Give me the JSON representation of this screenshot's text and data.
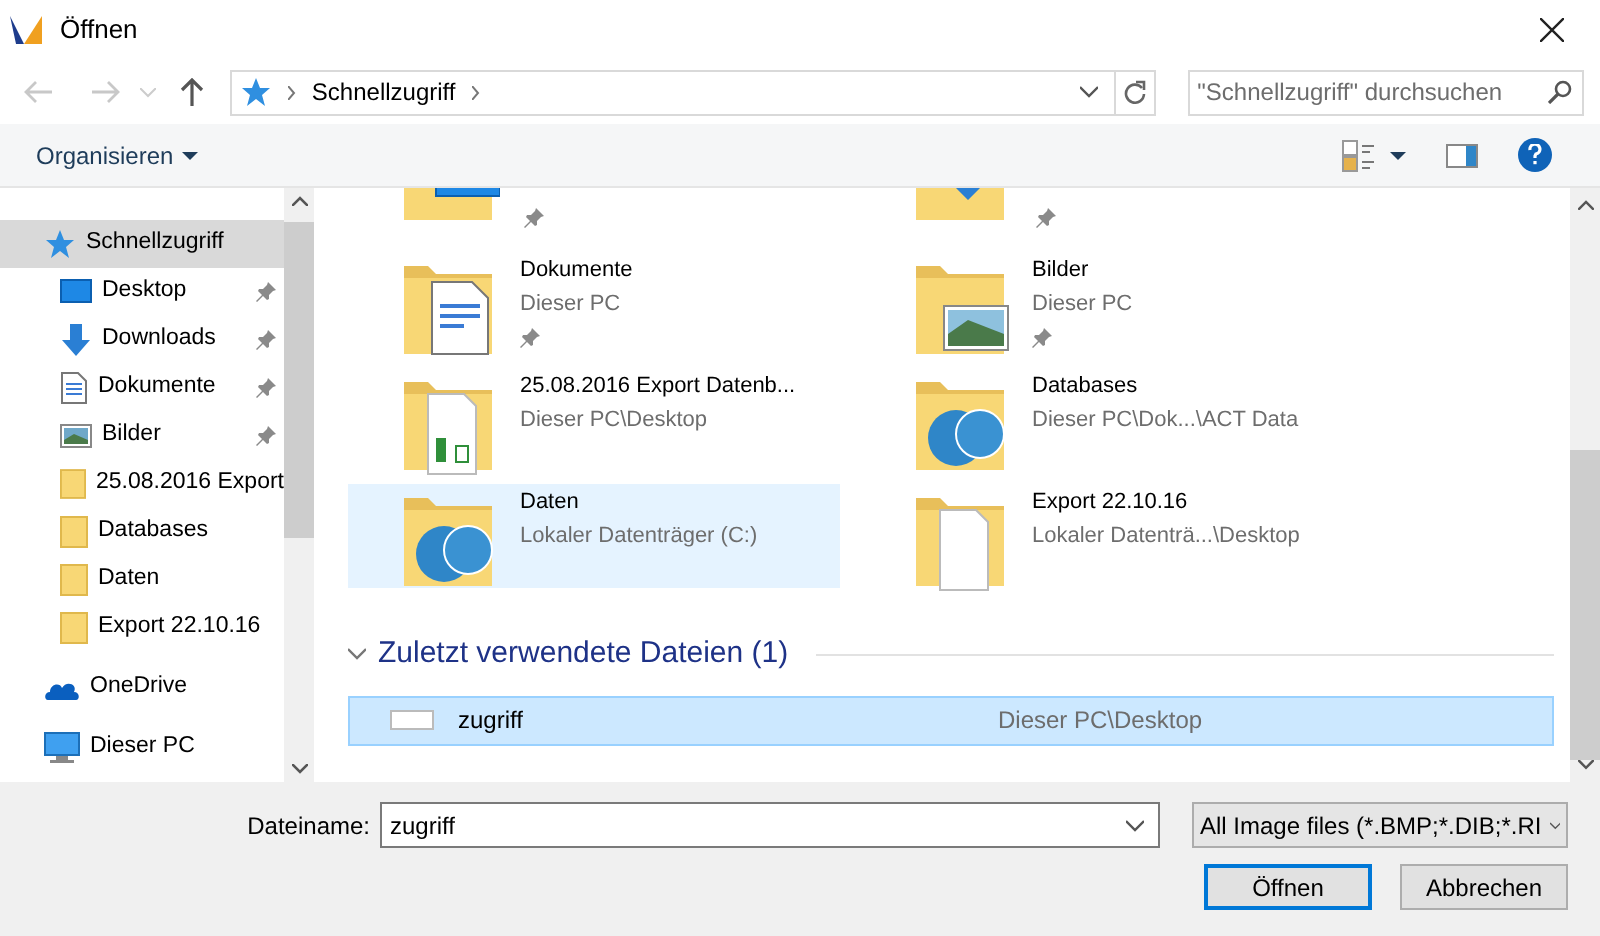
{
  "window": {
    "title": "Öffnen"
  },
  "address": {
    "path": "Schnellzugriff"
  },
  "search": {
    "placeholder": "\"Schnellzugriff\" durchsuchen"
  },
  "toolbar": {
    "organize": "Organisieren"
  },
  "sidebar": {
    "items": [
      {
        "label": "Schnellzugriff",
        "kind": "star",
        "selected": true,
        "pinned": false,
        "indent": false
      },
      {
        "label": "Desktop",
        "kind": "desktop",
        "selected": false,
        "pinned": true,
        "indent": true
      },
      {
        "label": "Downloads",
        "kind": "download",
        "selected": false,
        "pinned": true,
        "indent": true
      },
      {
        "label": "Dokumente",
        "kind": "document",
        "selected": false,
        "pinned": true,
        "indent": true
      },
      {
        "label": "Bilder",
        "kind": "picture",
        "selected": false,
        "pinned": true,
        "indent": true
      },
      {
        "label": "25.08.2016 Export",
        "kind": "folder",
        "selected": false,
        "pinned": false,
        "indent": true
      },
      {
        "label": "Databases",
        "kind": "folder",
        "selected": false,
        "pinned": false,
        "indent": true
      },
      {
        "label": "Daten",
        "kind": "folder",
        "selected": false,
        "pinned": false,
        "indent": true
      },
      {
        "label": "Export 22.10.16",
        "kind": "folder",
        "selected": false,
        "pinned": false,
        "indent": true
      },
      {
        "label": "OneDrive",
        "kind": "cloud",
        "selected": false,
        "pinned": false,
        "indent": false
      },
      {
        "label": "Dieser PC",
        "kind": "pc",
        "selected": false,
        "pinned": false,
        "indent": false
      }
    ]
  },
  "partial_tiles": [
    {
      "kind": "desktop",
      "pinned": true
    },
    {
      "kind": "download",
      "pinned": true
    }
  ],
  "tiles": [
    {
      "title": "Dokumente",
      "subtitle": "Dieser PC",
      "kind": "document",
      "pinned": true,
      "selected": false
    },
    {
      "title": "Bilder",
      "subtitle": "Dieser PC",
      "kind": "picture",
      "pinned": true,
      "selected": false
    },
    {
      "title": "25.08.2016 Export Datenb...",
      "subtitle": "Dieser PC\\Desktop",
      "kind": "sheet",
      "pinned": false,
      "selected": false
    },
    {
      "title": "Databases",
      "subtitle": "Dieser PC\\Dok...\\ACT Data",
      "kind": "act",
      "pinned": false,
      "selected": false
    },
    {
      "title": "Daten",
      "subtitle": "Lokaler Datenträger (C:)",
      "kind": "act",
      "pinned": false,
      "selected": true
    },
    {
      "title": "Export 22.10.16",
      "subtitle": "Lokaler Datenträ...\\Desktop",
      "kind": "paper",
      "pinned": false,
      "selected": false
    }
  ],
  "recent": {
    "heading": "Zuletzt verwendete Dateien (1)",
    "expanded": true,
    "files": [
      {
        "name": "zugriff",
        "location": "Dieser PC\\Desktop",
        "selected": true
      }
    ]
  },
  "footer": {
    "filename_label": "Dateiname:",
    "filename": "zugriff",
    "filetype": "All Image files (*.BMP;*.DIB;*.RI",
    "open": "Öffnen",
    "cancel": "Abbrechen"
  }
}
